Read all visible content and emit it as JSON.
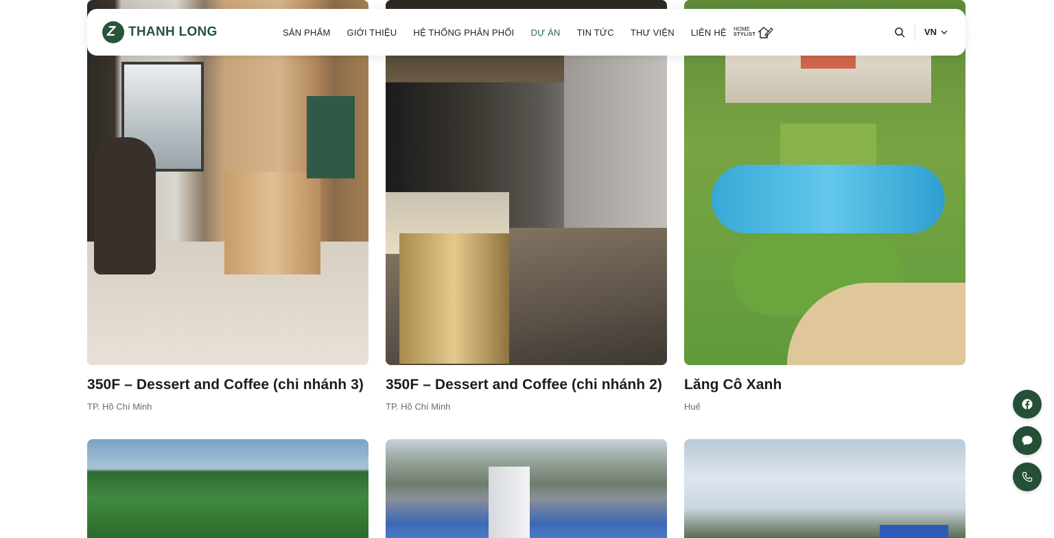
{
  "header": {
    "logo_text": "THANH LONG",
    "logo_mark": "Z",
    "nav": [
      {
        "label": "SẢN PHẨM",
        "active": false
      },
      {
        "label": "GIỚI THIỆU",
        "active": false
      },
      {
        "label": "HỆ THỐNG PHÂN PHỐI",
        "active": false
      },
      {
        "label": "DỰ ÁN",
        "active": true
      },
      {
        "label": "TIN TỨC",
        "active": false
      },
      {
        "label": "THƯ VIỆN",
        "active": false
      },
      {
        "label": "LIÊN HỆ",
        "active": false
      }
    ],
    "home_stylist": {
      "line1": "HOME",
      "line2": "STYLIST",
      "icon": "house-pencil-icon"
    },
    "search_icon": "search-icon",
    "language": "VN",
    "language_icon": "chevron-down-icon"
  },
  "projects": [
    {
      "title": "350F – Dessert and Coffee (chi nhánh 3)",
      "location": "TP. Hồ Chí Minh"
    },
    {
      "title": "350F – Dessert and Coffee (chi nhánh 2)",
      "location": "TP. Hồ Chí Minh"
    },
    {
      "title": "Lăng Cô Xanh",
      "location": "Huế"
    }
  ],
  "floating_buttons": [
    {
      "icon": "facebook-icon"
    },
    {
      "icon": "chat-icon"
    },
    {
      "icon": "phone-icon"
    }
  ],
  "colors": {
    "brand": "#27543a",
    "active_nav": "#2d6a3e",
    "fab": "#245038"
  }
}
